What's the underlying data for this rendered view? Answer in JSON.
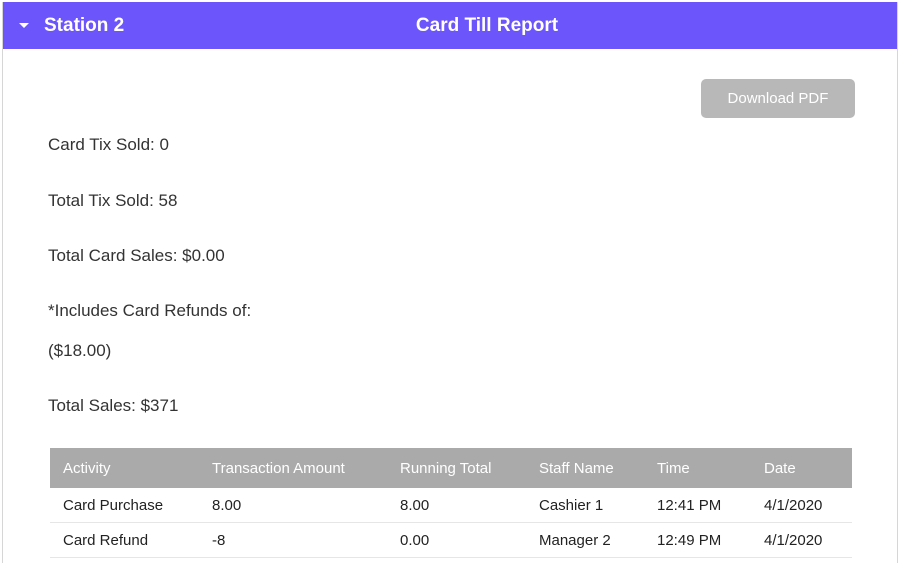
{
  "header": {
    "station": "Station 2",
    "title": "Card Till Report",
    "color": "#6b55fb"
  },
  "toolbar": {
    "download_label": "Download PDF"
  },
  "stats": {
    "card_tix_sold": "Card Tix Sold: 0",
    "total_tix_sold": "Total Tix Sold: 58",
    "total_card_sales": "Total Card Sales: $0.00",
    "refunds_label": "*Includes Card Refunds of:",
    "refunds_value": "($18.00)",
    "total_sales": "Total Sales: $371"
  },
  "table": {
    "headers": [
      "Activity",
      "Transaction Amount",
      "Running Total",
      "Staff Name",
      "Time",
      "Date"
    ],
    "rows": [
      [
        "Card Purchase",
        "8.00",
        "8.00",
        "Cashier 1",
        "12:41 PM",
        "4/1/2020"
      ],
      [
        "Card Refund",
        "-8",
        "0.00",
        "Manager 2",
        "12:49 PM",
        "4/1/2020"
      ]
    ]
  }
}
